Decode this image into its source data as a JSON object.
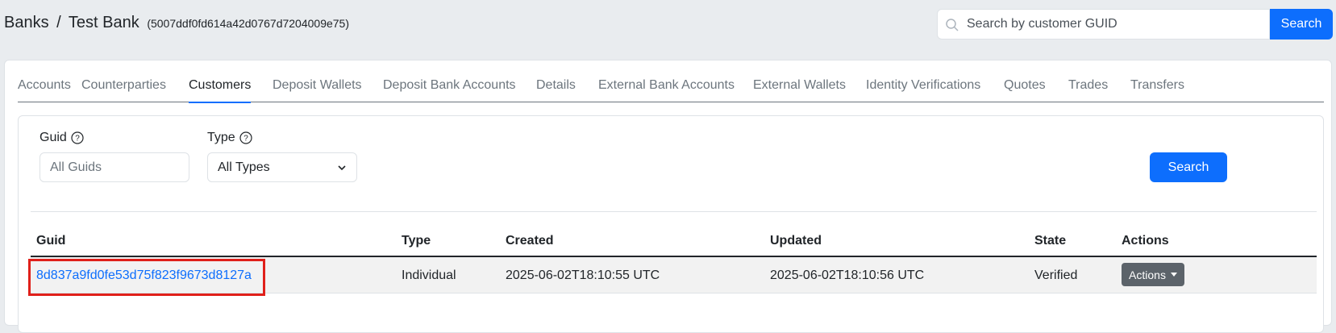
{
  "breadcrumb": {
    "section": "Banks",
    "separator": "/",
    "bank_name": "Test Bank",
    "bank_id": "(5007ddf0fd614a42d0767d7204009e75)"
  },
  "top_search": {
    "placeholder": "Search by customer GUID",
    "button_label": "Search"
  },
  "tabs": [
    {
      "label": "Accounts",
      "active": false
    },
    {
      "label": "Counterparties",
      "active": false
    },
    {
      "label": "Customers",
      "active": true
    },
    {
      "label": "Deposit Wallets",
      "active": false
    },
    {
      "label": "Deposit Bank Accounts",
      "active": false
    },
    {
      "label": "Details",
      "active": false
    },
    {
      "label": "External Bank Accounts",
      "active": false
    },
    {
      "label": "External Wallets",
      "active": false
    },
    {
      "label": "Identity Verifications",
      "active": false
    },
    {
      "label": "Quotes",
      "active": false
    },
    {
      "label": "Trades",
      "active": false
    },
    {
      "label": "Transfers",
      "active": false
    }
  ],
  "filters": {
    "guid_label": "Guid",
    "guid_placeholder": "All Guids",
    "type_label": "Type",
    "type_selected": "All Types",
    "search_label": "Search"
  },
  "table": {
    "columns": [
      "Guid",
      "Type",
      "Created",
      "Updated",
      "State",
      "Actions"
    ],
    "rows": [
      {
        "guid": "8d837a9fd0fe53d75f823f9673d8127a",
        "type": "Individual",
        "created": "2025-06-02T18:10:55 UTC",
        "updated": "2025-06-02T18:10:56 UTC",
        "state": "Verified",
        "actions_label": "Actions"
      }
    ]
  },
  "colors": {
    "primary": "#0d6efd",
    "highlight": "#e0201a",
    "secondary_button": "#5c636a"
  }
}
